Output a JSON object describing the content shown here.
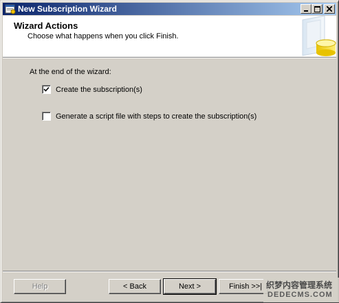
{
  "window": {
    "title": "New Subscription Wizard",
    "buttons": {
      "minimize": "_",
      "maximize": "□",
      "close": "✕"
    }
  },
  "header": {
    "title": "Wizard Actions",
    "subtitle": "Choose what happens when you click Finish.",
    "art_icon": "database-icon"
  },
  "body": {
    "section_label": "At the end of the wizard:",
    "options": [
      {
        "label": "Create the subscription(s)",
        "checked": true
      },
      {
        "label": "Generate a script file with steps to create the subscription(s)",
        "checked": false
      }
    ]
  },
  "footer": {
    "help_label": "Help",
    "back_label": "< Back",
    "next_label": "Next >",
    "finish_label": "Finish >>|"
  },
  "watermark": {
    "line1": "织梦内容管理系统",
    "line2": "DEDECMS.COM"
  },
  "colors": {
    "titlebar_start": "#0a246a",
    "titlebar_end": "#a6caf0",
    "face": "#d4d0c8"
  }
}
